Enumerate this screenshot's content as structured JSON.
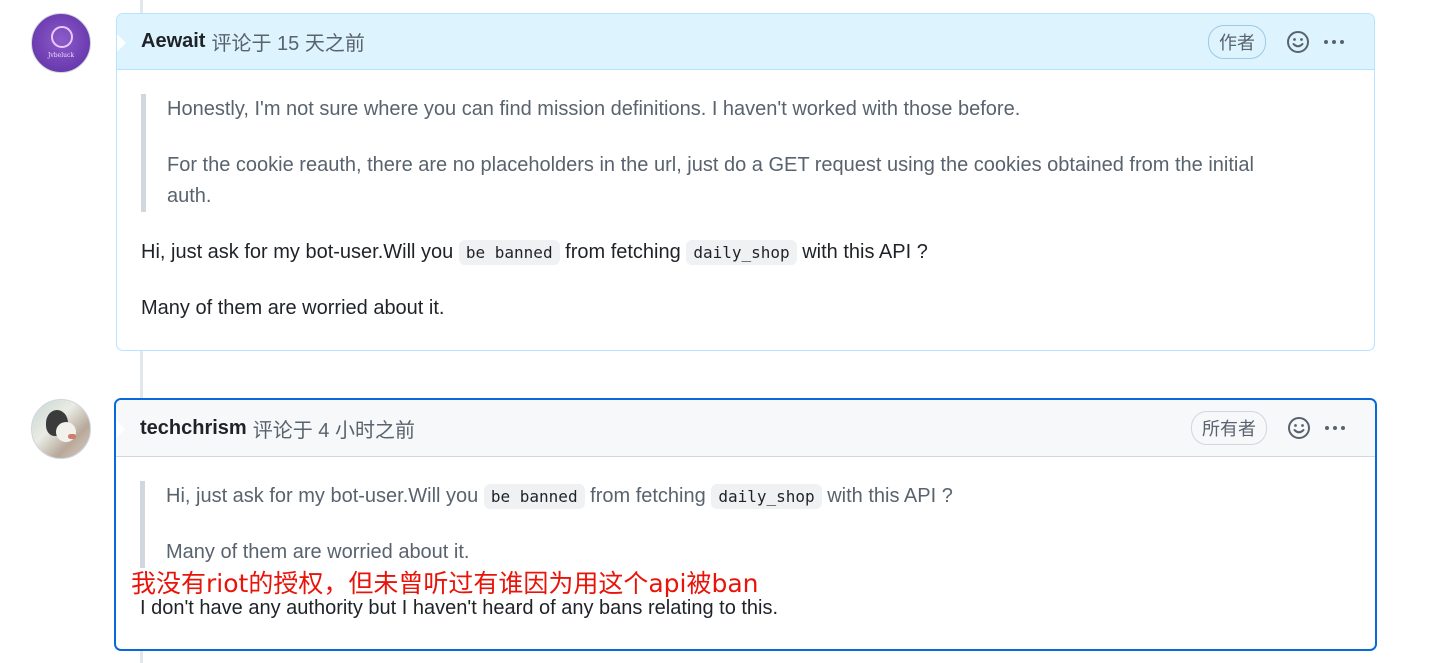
{
  "comments": [
    {
      "author": "Aewait",
      "meta": "评论于 15 天之前",
      "badge": "作者",
      "avatar_text": "Jvbeluck",
      "quote": [
        "Honestly, I'm not sure where you can find mission definitions. I haven't worked with those before.",
        "For the cookie reauth, there are no placeholders in the url, just do a GET request using the cookies obtained from the initial",
        "auth."
      ],
      "paragraph1": {
        "before": "Hi, just ask for my bot-user.Will you",
        "code1": "be banned",
        "middle": "from fetching",
        "code2": "daily_shop",
        "after": "with this API ?"
      },
      "paragraph2": "Many of them are worried about it."
    },
    {
      "author": "techchrism",
      "meta": "评论于 4 小时之前",
      "badge": "所有者",
      "quote": {
        "before": "Hi, just ask for my bot-user.Will you",
        "code1": "be banned",
        "middle": "from fetching",
        "code2": "daily_shop",
        "after": "with this API ?",
        "line2": "Many of them are worried about it."
      },
      "paragraph": "I don't have any authority but I haven't heard of any bans relating to this."
    }
  ],
  "annotation": "我没有riot的授权，但未曾听过有谁因为用这个api被ban",
  "icons": {
    "reaction": "smiley-icon",
    "more": "kebab-horizontal-icon"
  },
  "colors": {
    "author_header": "#ddf4ff",
    "focus_border": "#0969da",
    "annotation": "#e8140a"
  }
}
